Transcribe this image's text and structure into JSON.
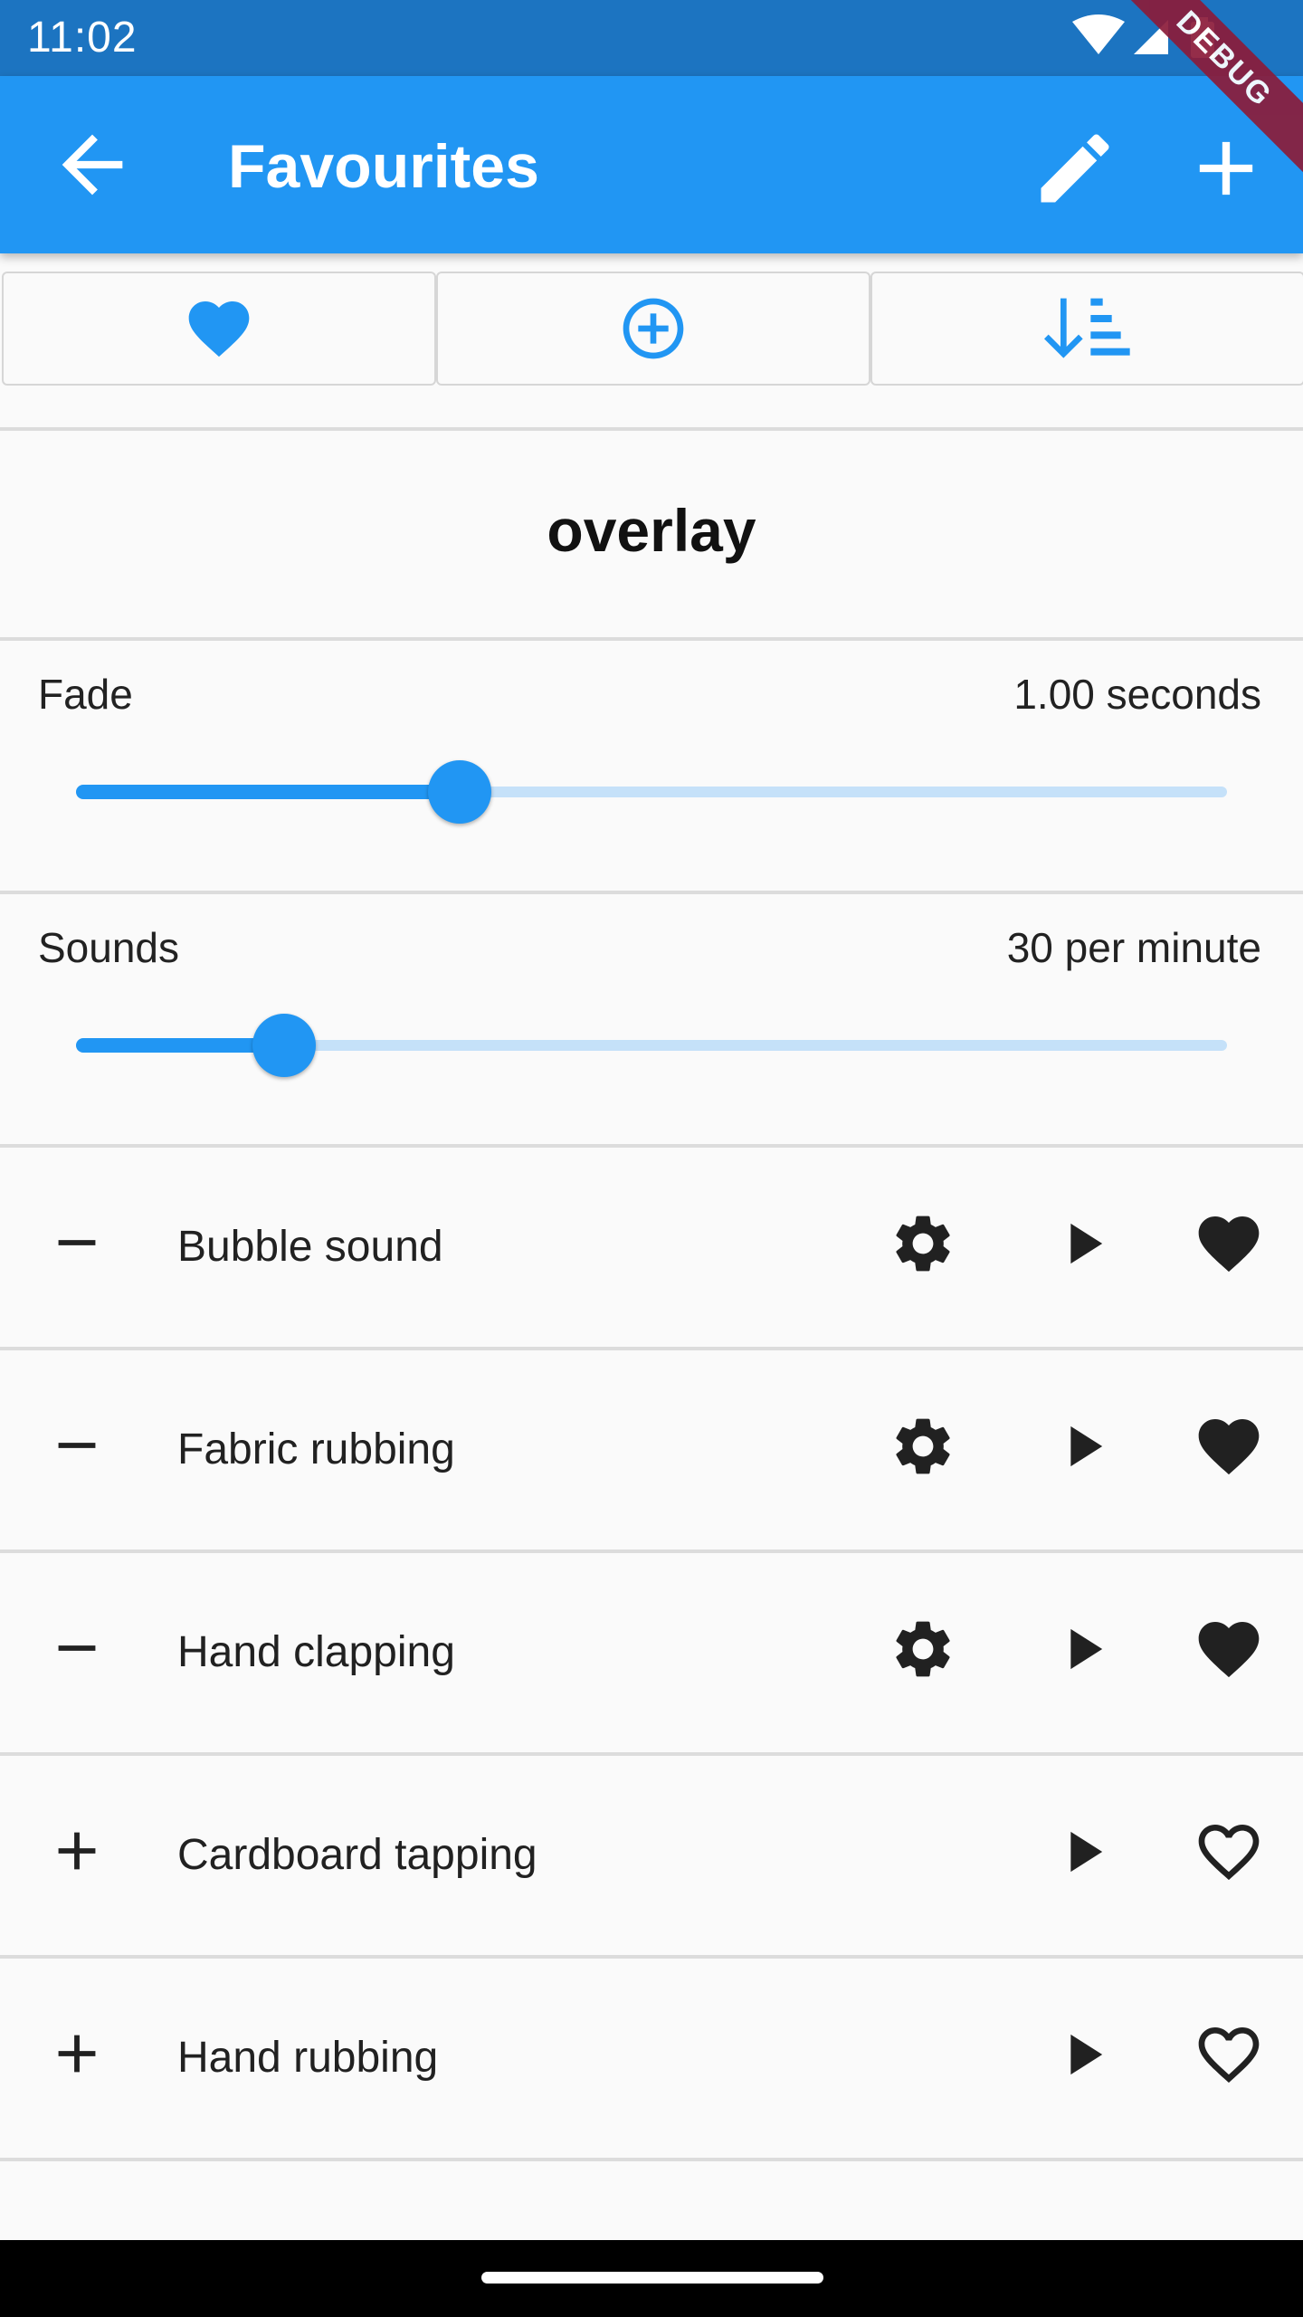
{
  "status_bar": {
    "time": "11:02",
    "icons": [
      "wifi-icon",
      "cell-signal-icon",
      "battery-icon"
    ]
  },
  "debug_banner": "DEBUG",
  "app_bar": {
    "title": "Favourites",
    "background": "#2196f3",
    "icons": [
      "back-arrow-icon",
      "pencil-icon",
      "plus-icon"
    ]
  },
  "toolbar": {
    "buttons": [
      "heart-filled-icon",
      "add-circle-outline-icon",
      "sort-icon"
    ]
  },
  "overlay": {
    "title": "overlay"
  },
  "fade": {
    "label": "Fade",
    "value": "1.00 seconds",
    "fraction": 0.333
  },
  "sounds_rate": {
    "label": "Sounds",
    "value": "30 per minute",
    "fraction": 0.181
  },
  "sound_list": [
    {
      "name": "Bubble sound",
      "selected": true,
      "favourite": true
    },
    {
      "name": "Fabric rubbing",
      "selected": true,
      "favourite": true
    },
    {
      "name": "Hand clapping",
      "selected": true,
      "favourite": true
    },
    {
      "name": "Cardboard tapping",
      "selected": false,
      "favourite": false
    },
    {
      "name": "Hand rubbing",
      "selected": false,
      "favourite": false
    }
  ],
  "colors": {
    "accent": "#2196f3",
    "status_bar": "#1c74c1",
    "track": "#c5e1f9"
  }
}
